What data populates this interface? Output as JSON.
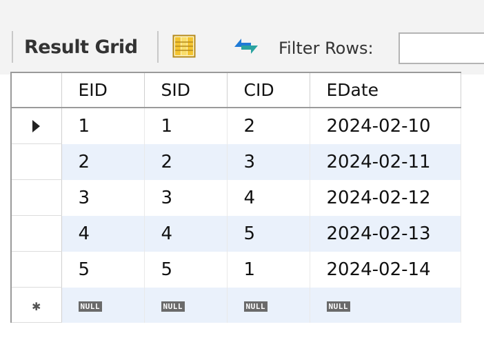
{
  "toolbar": {
    "result_grid_label": "Result Grid",
    "layout_icon": "form-layout-icon",
    "refresh_icon": "refresh-arrows-icon",
    "filter_label": "Filter Rows:",
    "filter_value": ""
  },
  "grid": {
    "columns": [
      "EID",
      "SID",
      "CID",
      "EDate"
    ],
    "rows": [
      [
        "1",
        "1",
        "2",
        "2024-02-10"
      ],
      [
        "2",
        "2",
        "3",
        "2024-02-11"
      ],
      [
        "3",
        "3",
        "4",
        "2024-02-12"
      ],
      [
        "4",
        "4",
        "5",
        "2024-02-13"
      ],
      [
        "5",
        "5",
        "1",
        "2024-02-14"
      ]
    ],
    "new_row": [
      "NULL",
      "NULL",
      "NULL",
      "NULL"
    ],
    "current_row_marker": "row-pointer-icon",
    "new_row_marker": "new-row-asterisk-icon"
  },
  "colors": {
    "toolbar_bg": "#f3f3f3",
    "alt_row_bg": "#eaf1fb",
    "null_chip_bg": "#6a6a6a",
    "refresh_blue": "#1f7ad6",
    "refresh_teal": "#2aa3a0"
  }
}
